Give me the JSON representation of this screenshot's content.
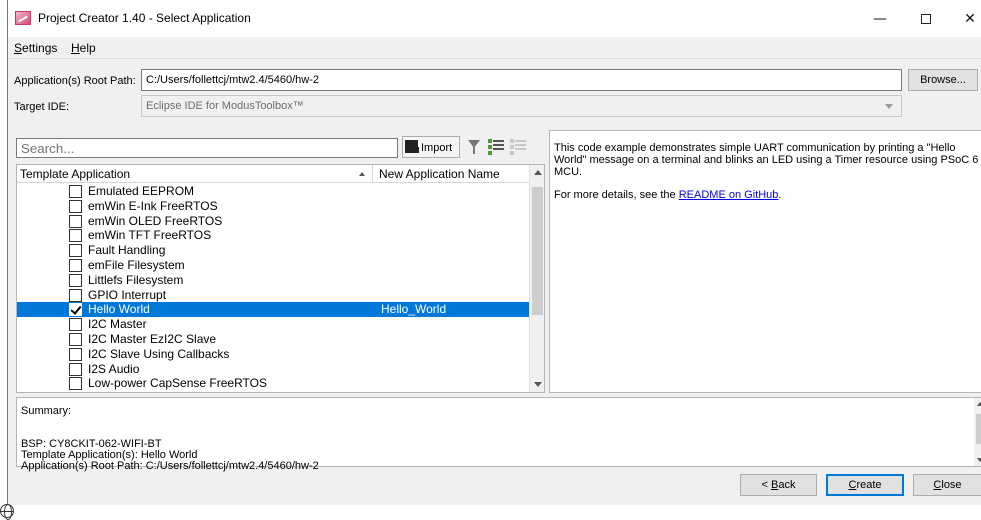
{
  "window": {
    "title": "Project Creator 1.40 - Select Application",
    "controls": {
      "minimize": "—",
      "close": "✕"
    }
  },
  "menu": {
    "settings_pre": "",
    "settings_u": "S",
    "settings_rest": "ettings",
    "help_u": "H",
    "help_rest": "elp"
  },
  "paths": {
    "root_label": "Application(s) Root Path:",
    "root_value": "C:/Users/follettcj/mtw2.4/5460/hw-2",
    "browse_label": "Browse...",
    "ide_label": "Target IDE:",
    "ide_value": "Eclipse IDE for ModusToolbox™"
  },
  "toolbar": {
    "search_placeholder": "Search...",
    "import_label": "Import"
  },
  "table": {
    "col_template": "Template Application",
    "col_appname": "New Application Name",
    "rows": [
      {
        "name": "Emulated EEPROM",
        "checked": false,
        "appname": ""
      },
      {
        "name": "emWin E-Ink FreeRTOS",
        "checked": false,
        "appname": ""
      },
      {
        "name": "emWin OLED FreeRTOS",
        "checked": false,
        "appname": ""
      },
      {
        "name": "emWin TFT FreeRTOS",
        "checked": false,
        "appname": ""
      },
      {
        "name": "Fault Handling",
        "checked": false,
        "appname": ""
      },
      {
        "name": "emFile Filesystem",
        "checked": false,
        "appname": ""
      },
      {
        "name": "Littlefs Filesystem",
        "checked": false,
        "appname": ""
      },
      {
        "name": "GPIO Interrupt",
        "checked": false,
        "appname": ""
      },
      {
        "name": "Hello World",
        "checked": true,
        "appname": "Hello_World",
        "selected": true
      },
      {
        "name": "I2C Master",
        "checked": false,
        "appname": ""
      },
      {
        "name": "I2C Master EzI2C Slave",
        "checked": false,
        "appname": ""
      },
      {
        "name": "I2C Slave Using Callbacks",
        "checked": false,
        "appname": ""
      },
      {
        "name": "I2S Audio",
        "checked": false,
        "appname": ""
      },
      {
        "name": "Low-power CapSense FreeRTOS",
        "checked": false,
        "appname": ""
      }
    ]
  },
  "description": {
    "para1": "This code example demonstrates simple UART communication by printing a \"Hello World\" message on a terminal and blinks an LED using a Timer resource using PSoC 6 MCU.",
    "para2_prefix": "For more details, see the ",
    "readme_link": "README on GitHub",
    "para2_suffix": "."
  },
  "summary": {
    "heading": "Summary:",
    "bsp": "BSP: CY8CKIT-062-WIFI-BT",
    "template": "Template Application(s): Hello World",
    "root": "Application(s) Root Path: C:/Users/follettcj/mtw2.4/5460/hw-2"
  },
  "buttons": {
    "back_pre": "< ",
    "back_u": "B",
    "back_rest": "ack",
    "create_u": "C",
    "create_rest": "reate",
    "close_u": "C",
    "close_rest": "lose"
  },
  "colors": {
    "selection": "#0078d7",
    "link": "#0000ee"
  }
}
